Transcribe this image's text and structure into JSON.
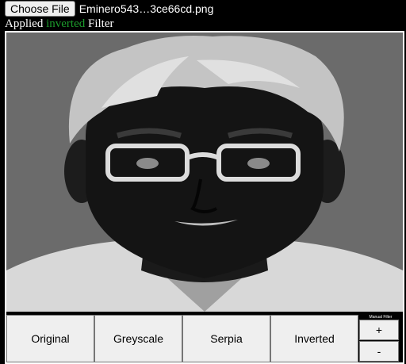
{
  "file_input": {
    "button_label": "Choose File",
    "file_name": "Eminero543…3ce66cd.png"
  },
  "status": {
    "prefix": "Applied",
    "filter": "inverted",
    "suffix": "Filter"
  },
  "filters": {
    "original": "Original",
    "greyscale": "Greyscale",
    "sepia": "Serpia",
    "inverted": "Inverted"
  },
  "manual_filter": {
    "label": "Manual Filter",
    "plus": "+",
    "minus": "-"
  },
  "colors": {
    "accent_status": "#1c9c2c",
    "background": "#000000",
    "button_bg": "#efefef"
  }
}
